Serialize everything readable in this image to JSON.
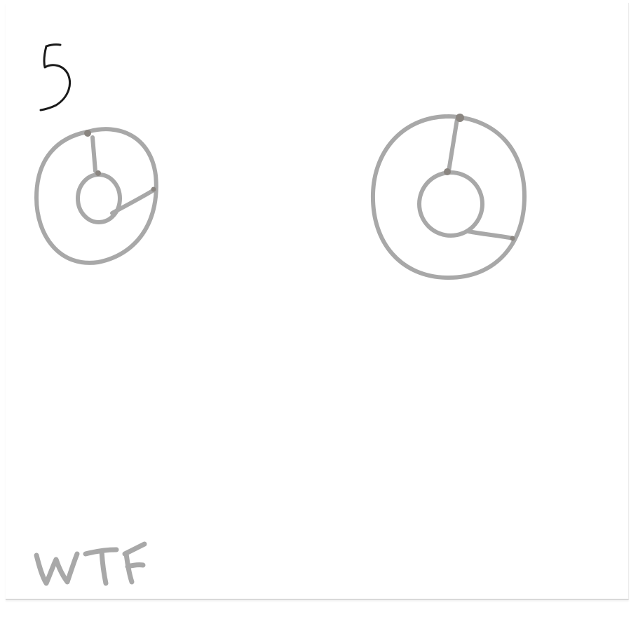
{
  "card": {
    "number_mark": "5",
    "signature": "WTF"
  },
  "colors": {
    "paper": "#ffffff",
    "pencil": "#a8a8a8",
    "pencil_dark": "#8a8580",
    "ink": "#1a1a1a"
  },
  "icons": [
    "circular-dial-icon",
    "circular-dial-icon"
  ]
}
